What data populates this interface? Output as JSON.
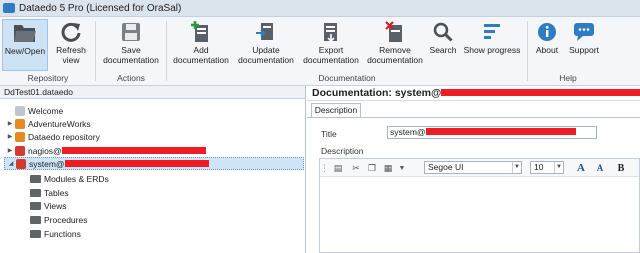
{
  "window": {
    "title": "Dataedo 5 Pro (Licensed for OraSal)"
  },
  "ribbon": {
    "buttons": [
      {
        "label": "New/Open",
        "icon": "folder-open-icon"
      },
      {
        "label": "Refresh\nview",
        "icon": "refresh-icon"
      },
      {
        "label": "Save\ndocumentation",
        "icon": "save-icon"
      },
      {
        "label": "Add\ndocumentation",
        "icon": "add-document-icon"
      },
      {
        "label": "Update\ndocumentation",
        "icon": "update-document-icon"
      },
      {
        "label": "Export\ndocumentation",
        "icon": "export-document-icon"
      },
      {
        "label": "Remove\ndocumentation",
        "icon": "remove-document-icon"
      },
      {
        "label": "Search",
        "icon": "search-icon"
      },
      {
        "label": "Show progress",
        "icon": "progress-icon"
      },
      {
        "label": "About",
        "icon": "info-icon"
      },
      {
        "label": "Support",
        "icon": "chat-icon"
      }
    ],
    "groups": [
      "Repository",
      "Actions",
      "Documentation",
      "Help"
    ]
  },
  "tree": {
    "header": "DdTest01.dataedo",
    "items": [
      {
        "label": "Welcome"
      },
      {
        "label": "AdventureWorks"
      },
      {
        "label": "Dataedo repository"
      },
      {
        "label": "nagios@"
      },
      {
        "label": "system@"
      }
    ],
    "children": [
      "Modules & ERDs",
      "Tables",
      "Views",
      "Procedures",
      "Functions"
    ]
  },
  "doc": {
    "title_prefix": "Documentation: system@",
    "tab": "Description",
    "title_label": "Title",
    "title_value": "system@",
    "description_label": "Description",
    "font": "Segoe UI",
    "font_size": "10"
  },
  "colors": {
    "redaction": "#ee1c25",
    "accent": "#2e7dc2"
  }
}
